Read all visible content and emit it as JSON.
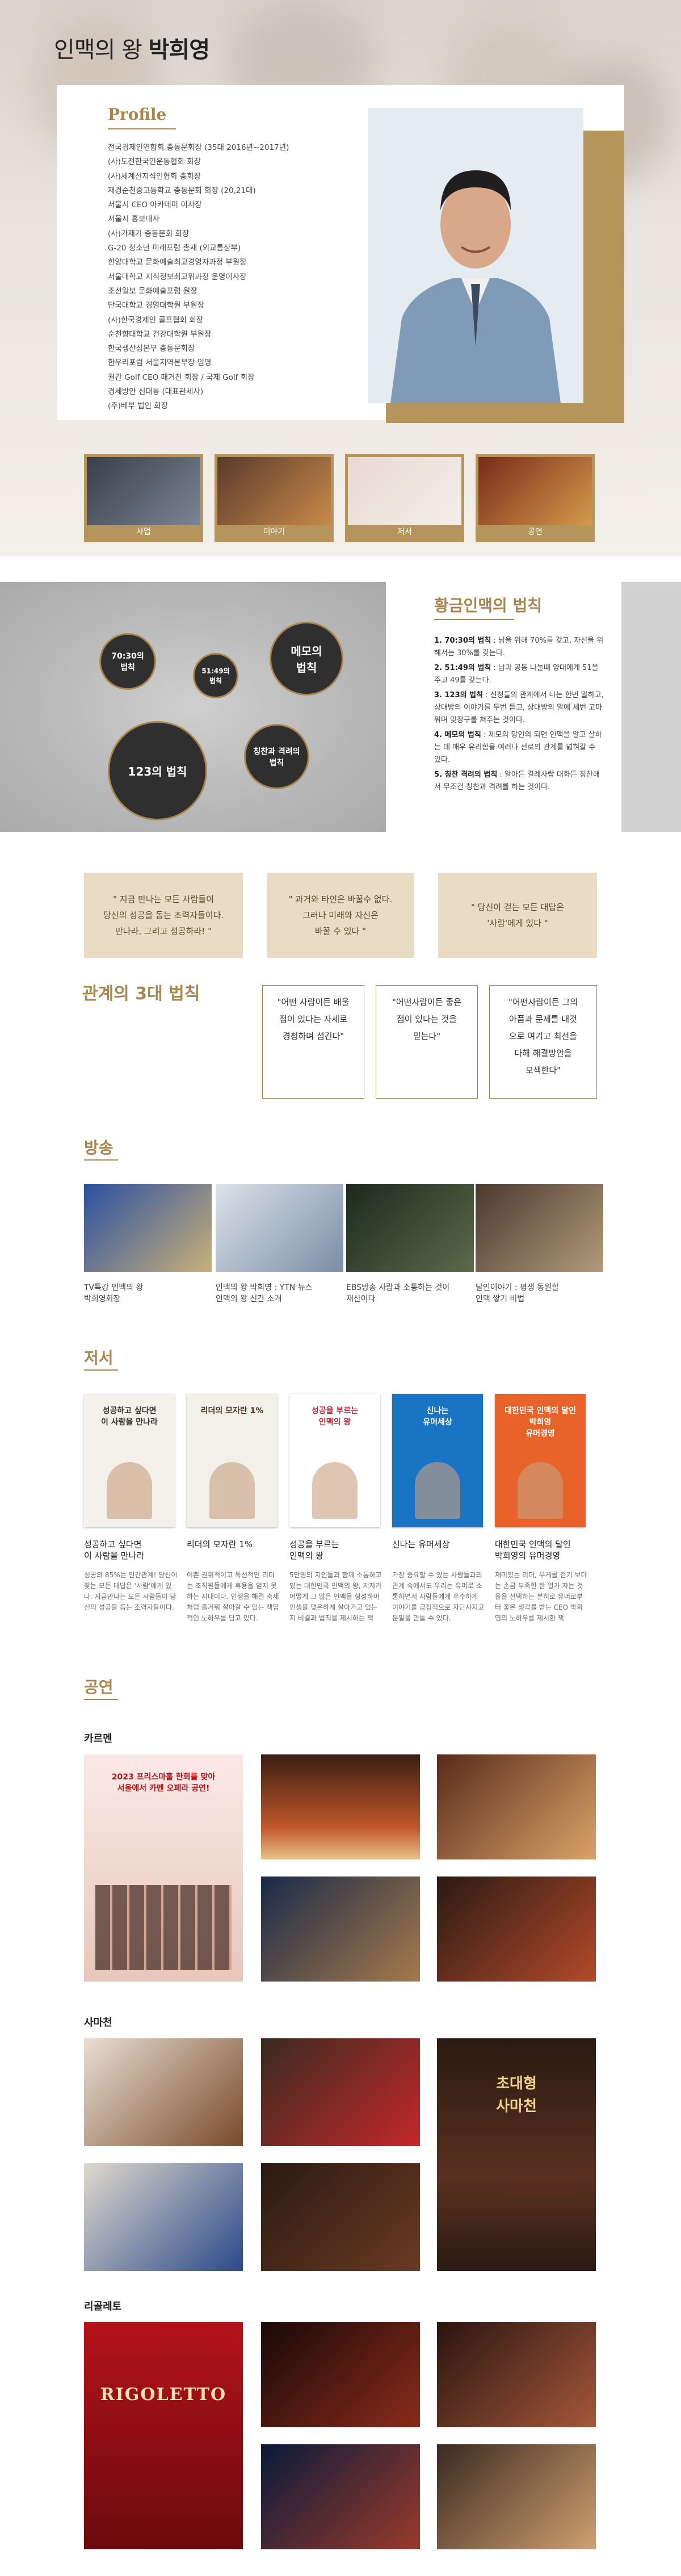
{
  "hero": {
    "title_prefix": "인맥의 왕 ",
    "title_name": "박희영"
  },
  "profile": {
    "heading": "Profile",
    "items": [
      "전국경제인연합회 총동문회장 (35대 2016년~2017년)",
      "(사)도전한국인운동협회 회장",
      "(사)세계신지식인협회 총회장",
      "재경순천중고등학교 총동문회 회장 (20,21대)",
      "서울시 CEO 아카데미 이사장",
      "서울시 홍보대사",
      "(사)가재기 총동문회 회장",
      "G-20 청소년 미래포럼 총재 (외교통상부)",
      "한양대학교 문화예술최고경영자과정 부원장",
      "서울대학교 지식정보최고위과정 운영이사장",
      "조선일보 문화예술포럼 원장",
      "단국대학교 경영대학원 부원장",
      "(사)한국경제인 골프협회 회장",
      "순천향대학교 건강대학원 부원장",
      "한국생산성본부 총동문회장",
      "한우리포럼 서울지역본부장 임명",
      "월간 Golf CEO 매거진 회장 / 국제 Golf 회장",
      "경세방안 신대동 (대표관세사)",
      "(주)베부 법인 회장"
    ]
  },
  "thumbs": [
    {
      "label": "사업"
    },
    {
      "label": "이야기"
    },
    {
      "label": "저서"
    },
    {
      "label": "공연"
    }
  ],
  "law": {
    "circles": [
      "70:30의\n법칙",
      "51:49의\n법칙",
      "메모의\n법칙",
      "123의 법칙",
      "칭찬과 격려의\n법칙"
    ],
    "heading": "황금인맥의 법칙",
    "items": [
      {
        "num": "1. ",
        "name": "70:30의 법칙",
        "desc": " : 남을 위해 70%를 갖고, 자신을 위해서는 30%를 갖는다."
      },
      {
        "num": "2. ",
        "name": "51:49의 법칙",
        "desc": " : 남과 공동 나눌때 양대에게 51을 주고 49를 갖는다."
      },
      {
        "num": "3. ",
        "name": "123의 법칙",
        "desc": " : 신청들의 관계에서 나는 한번 말하고, 상대방의 이야기를 두번 듣고, 상대방의 말에 세번 고마워며 맞장구를 쳐주는 것이다."
      },
      {
        "num": "4. ",
        "name": "메모의 법칙",
        "desc": " : 제모의 당인의 되면 인맥을 알고 살하는 데 매우 유리함을 여러나 선로의 관계를 넓혀갈 수 있다."
      },
      {
        "num": "5. ",
        "name": "칭찬 격려의 법칙",
        "desc": " : 알아든 결례사람 대화든 칭찬해서 무조건 칭찬과 격려를 하는 것이다."
      }
    ]
  },
  "quotes": [
    "\" 지금 만나는 모든 사람들이\n당신의 성공을 돕는 조력자들이다.\n만나라, 그리고 성공하라! \"",
    "\" 과거와 타인은 바꿀수 없다.\n그러나 미래와 자신은\n바꿀 수 있다 \"",
    "\" 당신이 걷는 모든 대답은\n'사람'에게 있다 \""
  ],
  "three_laws": {
    "heading": "관계의 3대 법칙",
    "items": [
      "\"어떤 사람이든 배울\n점이 있다는 자세로\n경청하며 섬긴다\"",
      "\"어떤사람이든 좋은\n점이 있다는 것을\n믿는다\"",
      "\"어떤사람이든 그의\n아픔과 문제를 내것\n으로 여기고 최선을\n다해 해결방안을\n모색한다\""
    ]
  },
  "broadcast": {
    "heading": "방송",
    "items": [
      "TV특강 인맥의 왕\n박희영회장",
      "인맥의 왕 박희영 : YTN 뉴스\n인맥의 왕 신간 소개",
      "EBS방송 사람과 소통하는 것이\n재산이다",
      "달인이야기 : 평생 동원할\n인맥 쌓기 비법"
    ]
  },
  "books": {
    "heading": "저서",
    "items": [
      {
        "cover": "성공하고 싶다면\n이 사람을 만나라",
        "title": "성공하고 싶다면\n이 사람을 만나라",
        "desc": "성공의 85%는 인간관계! 당신이 찾는 모든 대답은 '사람'에게 있다. 지금만나는 모든 사람들이 당신의 성공을 돕는 조력자들이다."
      },
      {
        "cover": "리더의 모자란 1%",
        "title": "리더의 모자란 1%",
        "desc": "이쁜 권위적이고 독선적인 리더는 조직원들에게 휴용을 얻지 못하는 시대이다. 인생을 해결 축제처럼 즐거워 살아갈 수 있는 책임적인 노하우를 담고 있다."
      },
      {
        "cover": "성공을 부르는\n인맥의 왕",
        "title": "성공을 부르는\n인맥의 왕",
        "desc": "5만명의 지인들과 함께 소통하고 있는 대한민국 인맥의 왕, 저자가 어떻게 그 많은 인맥을 형성하며 인생을 맺은하게 살아가고 있는지 비결과 법칙을 제시하는 책"
      },
      {
        "cover": "신나는\n유머세상",
        "title": "신나는 유머세상",
        "desc": "가장 중요할 수 있는 사람들과의 관계 속에서도 우리는 유머로 소통하면서 사람들에게 우수하게 이야기를 긍정적으로 자단사지고 문일을 만들 수 있다."
      },
      {
        "cover": "대한민국 인맥의 달인\n박희영\n유머경영",
        "title": "대한민국 인맥의 달인\n박희영의 유머경영",
        "desc": "재미있는 리더, 무게를 걷기 보다는 손금 부족한 한 얼가 자는 것을을 선택하는 분히로 유머로부터 좋은 생각를 받는 CEO 박희영의 노하우를 제시한 책"
      }
    ]
  },
  "performances": {
    "heading": "공연",
    "groups": [
      {
        "name": "카르멘",
        "poster": "2023 프리스마홀 한회를 맞아\n서울에서 카멘 오페라 공연!"
      },
      {
        "name": "사마천",
        "poster": "초대형\n사마천"
      },
      {
        "name": "리골레토",
        "poster": "RIGOLETTO"
      }
    ]
  }
}
